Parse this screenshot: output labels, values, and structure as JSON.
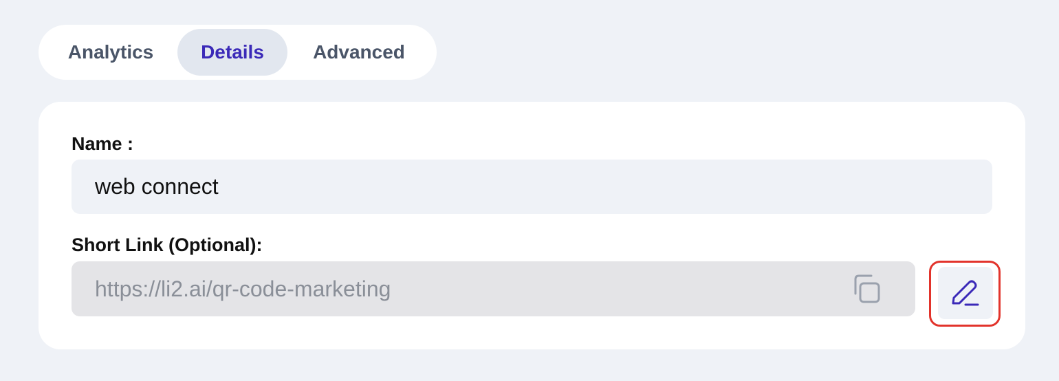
{
  "tabs": [
    {
      "label": "Analytics",
      "active": false
    },
    {
      "label": "Details",
      "active": true
    },
    {
      "label": "Advanced",
      "active": false
    }
  ],
  "form": {
    "name_label": "Name :",
    "name_value": "web connect",
    "short_link_label": "Short Link (Optional):",
    "short_link_value": "https://li2.ai/qr-code-marketing"
  },
  "icons": {
    "copy": "copy-icon",
    "edit": "pencil-icon"
  },
  "colors": {
    "background": "#eff2f7",
    "active_tab_text": "#3b2ab8",
    "active_tab_bg": "#e2e7ef",
    "highlight_border": "#e2332b",
    "disabled_field_bg": "#e4e4e7"
  }
}
